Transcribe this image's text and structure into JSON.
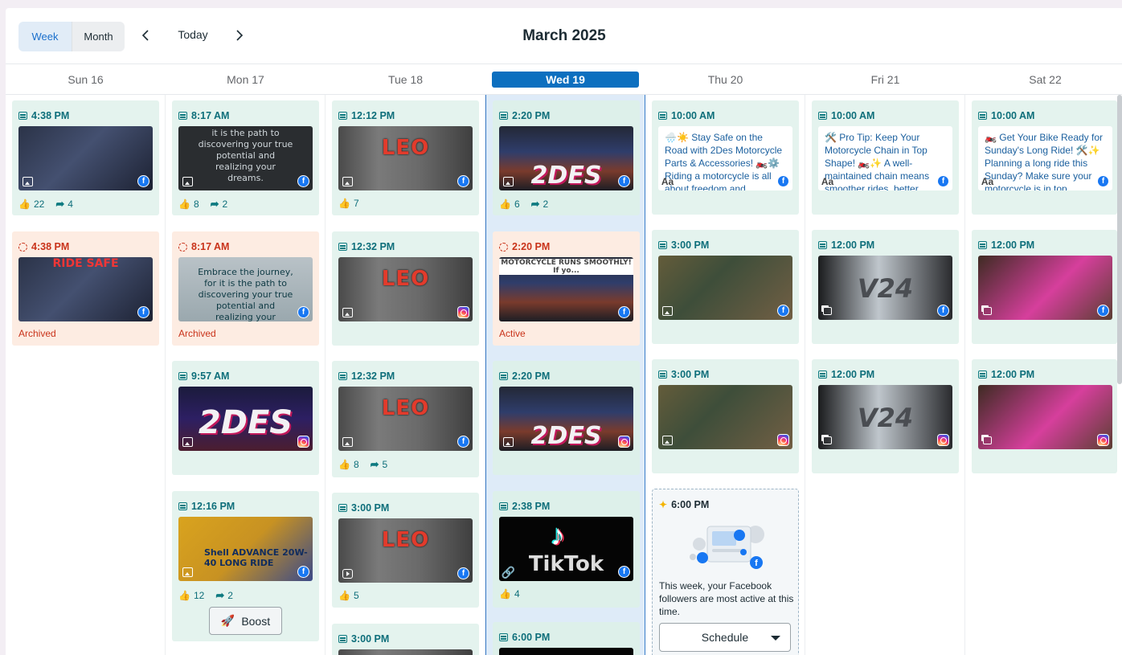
{
  "toolbar": {
    "view_week": "Week",
    "view_month": "Month",
    "today": "Today",
    "title": "March 2025"
  },
  "days": [
    {
      "label": "Sun 16"
    },
    {
      "label": "Mon 17"
    },
    {
      "label": "Tue 18"
    },
    {
      "label": "Wed 19",
      "active": true
    },
    {
      "label": "Thu 20"
    },
    {
      "label": "Fri 21"
    },
    {
      "label": "Sat 22"
    }
  ],
  "columns": {
    "sun": {
      "cards": [
        {
          "time": "4:38 PM",
          "type": "image",
          "network": "facebook",
          "likes": "22",
          "shares": "4"
        },
        {
          "time": "4:38 PM",
          "type": "image",
          "network": "facebook",
          "status": "Archived",
          "overlay": "RIDE SAFE"
        }
      ]
    },
    "mon": {
      "cards": [
        {
          "time": "8:17 AM",
          "type": "image",
          "network": "facebook",
          "likes": "8",
          "shares": "2",
          "overlay": "it is the path to discovering your true potential and realizing your dreams."
        },
        {
          "time": "8:17 AM",
          "type": "image",
          "network": "facebook",
          "status": "Archived",
          "overlay": "Embrace the journey, for it is the path to discovering your true potential and realizing your dreams."
        },
        {
          "time": "9:57 AM",
          "type": "image",
          "network": "instagram",
          "overlay": "2DES"
        },
        {
          "time": "12:16 PM",
          "type": "image",
          "network": "facebook",
          "likes": "12",
          "shares": "2",
          "overlay": "Shell ADVANCE 20W-40 LONG RIDE",
          "boost": "Boost"
        }
      ]
    },
    "tue": {
      "cards": [
        {
          "time": "12:12 PM",
          "type": "image",
          "network": "facebook",
          "likes": "7",
          "overlay": "LEO"
        },
        {
          "time": "12:32 PM",
          "type": "image",
          "network": "instagram",
          "overlay": "LEO"
        },
        {
          "time": "12:32 PM",
          "type": "image",
          "network": "facebook",
          "likes": "8",
          "shares": "5",
          "overlay": "LEO"
        },
        {
          "time": "3:00 PM",
          "type": "reel",
          "network": "facebook",
          "likes": "5",
          "overlay": "LEO"
        },
        {
          "time": "3:00 PM"
        }
      ]
    },
    "wed": {
      "cards": [
        {
          "time": "2:20 PM",
          "type": "image",
          "network": "facebook",
          "likes": "6",
          "shares": "2",
          "overlay": "2DES"
        },
        {
          "time": "2:20 PM",
          "type": "image",
          "network": "facebook",
          "status": "Active",
          "overlay": "MOTORCYCLE RUNS SMOOTHLY! If yo..."
        },
        {
          "time": "2:20 PM",
          "type": "image",
          "network": "instagram",
          "overlay": "2DES"
        },
        {
          "time": "2:38 PM",
          "type": "link",
          "network": "facebook",
          "likes": "4",
          "overlay": "TikTok"
        },
        {
          "time": "6:00 PM"
        }
      ]
    },
    "thu": {
      "cards": [
        {
          "time": "10:00 AM",
          "type": "text",
          "network": "facebook",
          "text": "🌧️☀️ Stay Safe on the Road with 2Des Motorcycle Parts & Accessories! 🏍️⚙️ Riding a motorcycle is all about freedom and"
        },
        {
          "time": "3:00 PM",
          "type": "image",
          "network": "facebook"
        },
        {
          "time": "3:00 PM",
          "type": "image",
          "network": "instagram"
        }
      ],
      "suggestion": {
        "time": "6:00 PM",
        "text": "This week, your Facebook followers are most active at this time.",
        "button": "Schedule"
      }
    },
    "fri": {
      "cards": [
        {
          "time": "10:00 AM",
          "type": "text",
          "network": "facebook",
          "text": "🛠️ Pro Tip: Keep Your Motorcycle Chain in Top Shape! 🏍️✨ A well-maintained chain means smoother rides, better"
        },
        {
          "time": "12:00 PM",
          "type": "multi",
          "network": "facebook",
          "overlay": "V24"
        },
        {
          "time": "12:00 PM",
          "type": "multi",
          "network": "instagram",
          "overlay": "V24"
        }
      ]
    },
    "sat": {
      "cards": [
        {
          "time": "10:00 AM",
          "type": "text",
          "network": "facebook",
          "text": "🏍️ Get Your Bike Ready for Sunday's Long Ride! 🛠️✨ Planning a long ride this Sunday? Make sure your motorcycle is in top"
        },
        {
          "time": "12:00 PM",
          "type": "multi",
          "network": "facebook"
        },
        {
          "time": "12:00 PM",
          "type": "multi",
          "network": "instagram"
        }
      ]
    }
  },
  "colors": {
    "accent": "#0c6fbf",
    "published_card": "#e4f3ee",
    "archived_card": "#fdece2",
    "time_text": "#0d6e7a",
    "archived_text": "#c9331a",
    "facebook": "#1877f2"
  }
}
